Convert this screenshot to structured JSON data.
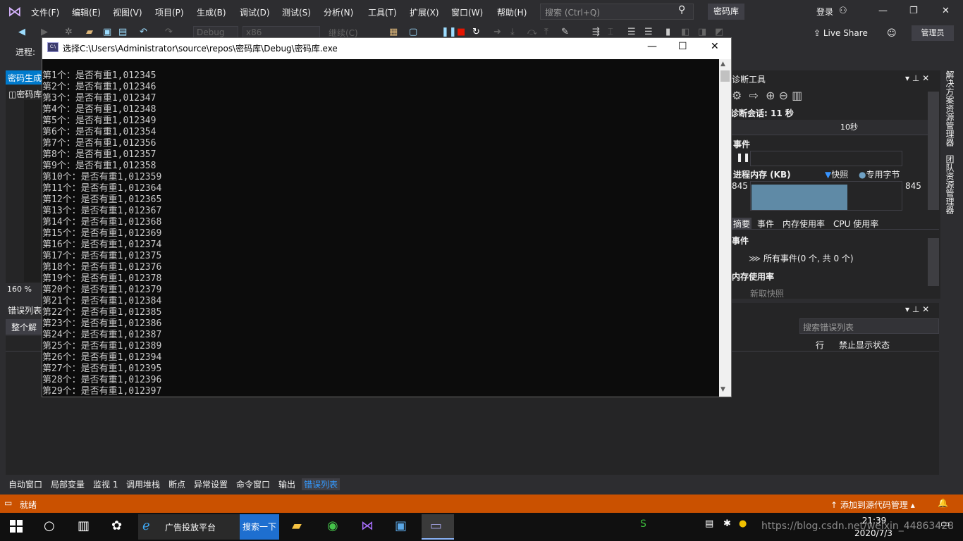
{
  "menubar": {
    "items": [
      "文件(F)",
      "编辑(E)",
      "视图(V)",
      "项目(P)",
      "生成(B)",
      "调试(D)",
      "测试(S)",
      "分析(N)",
      "工具(T)",
      "扩展(X)",
      "窗口(W)",
      "帮助(H)"
    ],
    "search_placeholder": "搜索 (Ctrl+Q)",
    "solution_name": "密码库",
    "login": "登录"
  },
  "toolbar": {
    "config": "Debug",
    "platform": "x86",
    "continue": "继续(C)",
    "live_share": "Live Share",
    "admin": "管理员",
    "progress_label": "进程:"
  },
  "left_panel": {
    "tab": "密码生成",
    "doc_title": "密码库",
    "zoom": "160 %"
  },
  "error_list": {
    "title": "错误列表",
    "scope": "整个解",
    "search_placeholder": "搜索错误列表",
    "col_line": "行",
    "col_suppress": "禁止显示状态"
  },
  "diagnostics": {
    "title": "诊断工具",
    "session": "诊断会话: 11 秒",
    "time_label": "10秒",
    "events_label": "事件",
    "mem_label": "进程内存 (KB)",
    "snapshot_legend": "快照",
    "private_legend": "专用字节",
    "mem_left": "845",
    "mem_right": "845",
    "tabs": [
      "摘要",
      "事件",
      "内存使用率",
      "CPU 使用率"
    ],
    "sec_events": "事件",
    "all_events": "所有事件(0 个, 共 0 个)",
    "sec_mem": "内存使用率",
    "snapshot_btn": "新取快照"
  },
  "right_vertical_tabs": [
    "解决方案资源管理器",
    "团队资源管理器"
  ],
  "bottom_tabs": [
    "自动窗口",
    "局部变量",
    "监视 1",
    "调用堆栈",
    "断点",
    "异常设置",
    "命令窗口",
    "输出",
    "错误列表"
  ],
  "status": {
    "text": "就绪",
    "source_control": "添加到源代码管理"
  },
  "console": {
    "title": "选择C:\\Users\\Administrator\\source\\repos\\密码库\\Debug\\密码库.exe",
    "lines": [
      "第1个：是否有重1,012345",
      "第2个：是否有重1,012346",
      "第3个：是否有重1,012347",
      "第4个：是否有重1,012348",
      "第5个：是否有重1,012349",
      "第6个：是否有重1,012354",
      "第7个：是否有重1,012356",
      "第8个：是否有重1,012357",
      "第9个：是否有重1,012358",
      "第10个：是否有重1,012359",
      "第11个：是否有重1,012364",
      "第12个：是否有重1,012365",
      "第13个：是否有重1,012367",
      "第14个：是否有重1,012368",
      "第15个：是否有重1,012369",
      "第16个：是否有重1,012374",
      "第17个：是否有重1,012375",
      "第18个：是否有重1,012376",
      "第19个：是否有重1,012378",
      "第20个：是否有重1,012379",
      "第21个：是否有重1,012384",
      "第22个：是否有重1,012385",
      "第23个：是否有重1,012386",
      "第24个：是否有重1,012387",
      "第25个：是否有重1,012389",
      "第26个：是否有重1,012394",
      "第27个：是否有重1,012395",
      "第28个：是否有重1,012396",
      "第29个：是否有重1,012397"
    ]
  },
  "taskbar": {
    "ie_label": "广告投放平台",
    "ie_search": "搜索一下",
    "time": "21:39",
    "date": "2020/7/3",
    "watermark": "https://blog.csdn.net/weixin_44863428"
  },
  "colors": {
    "status_bar": "#ca5100",
    "accent": "#007acc",
    "console_bg": "#0c0c0c"
  }
}
